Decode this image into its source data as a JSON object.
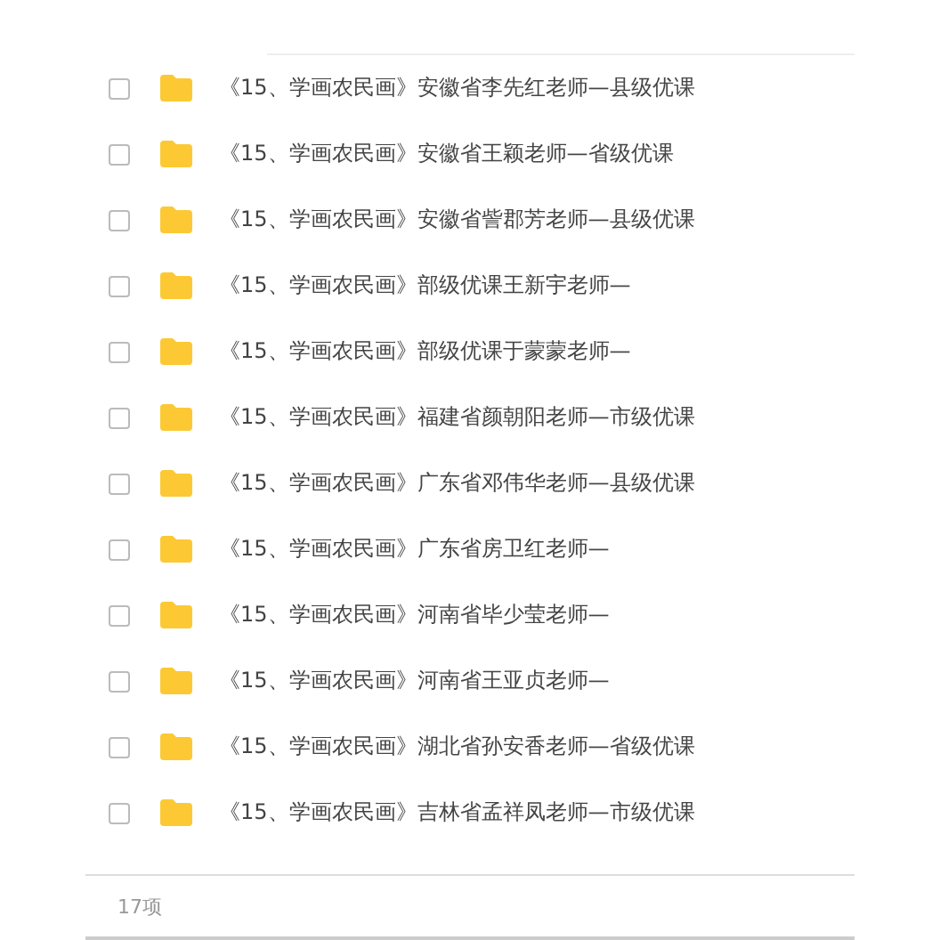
{
  "files": [
    {
      "name": "《15、学画农民画》安徽省李先红老师—县级优课",
      "checked": false
    },
    {
      "name": "《15、学画农民画》安徽省王颖老师—省级优课",
      "checked": false
    },
    {
      "name": "《15、学画农民画》安徽省訾郡芳老师—县级优课",
      "checked": false
    },
    {
      "name": "《15、学画农民画》部级优课王新宇老师—",
      "checked": false
    },
    {
      "name": "《15、学画农民画》部级优课于蒙蒙老师—",
      "checked": false
    },
    {
      "name": "《15、学画农民画》福建省颜朝阳老师—市级优课",
      "checked": false
    },
    {
      "name": "《15、学画农民画》广东省邓伟华老师—县级优课",
      "checked": false
    },
    {
      "name": "《15、学画农民画》广东省房卫红老师—",
      "checked": false
    },
    {
      "name": "《15、学画农民画》河南省毕少莹老师—",
      "checked": false
    },
    {
      "name": "《15、学画农民画》河南省王亚贞老师—",
      "checked": false
    },
    {
      "name": "《15、学画农民画》湖北省孙安香老师—省级优课",
      "checked": false
    },
    {
      "name": "《15、学画农民画》吉林省孟祥凤老师—市级优课",
      "checked": false
    }
  ],
  "status_bar": {
    "count": "17项"
  }
}
